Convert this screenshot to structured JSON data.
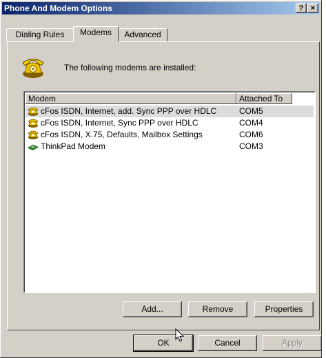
{
  "window": {
    "title": "Phone And Modem Options",
    "help_button": "?",
    "close_button": "×"
  },
  "tabs": [
    {
      "label": "Dialing Rules",
      "active": false
    },
    {
      "label": "Modems",
      "active": true
    },
    {
      "label": "Advanced",
      "active": false
    }
  ],
  "modems_tab": {
    "intro": "The following modems are installed:",
    "columns": [
      "Modem",
      "Attached To"
    ],
    "rows": [
      {
        "modem": "cFos ISDN, Internet, add. Sync PPP over HDLC",
        "port": "COM5",
        "icon": "isdn-modem-icon",
        "selected": true
      },
      {
        "modem": "cFos ISDN, Internet, Sync PPP over HDLC",
        "port": "COM4",
        "icon": "isdn-modem-icon",
        "selected": false
      },
      {
        "modem": "cFos ISDN, X.75, Defaults, Mailbox Settings",
        "port": "COM6",
        "icon": "isdn-modem-icon",
        "selected": false
      },
      {
        "modem": "ThinkPad Modem",
        "port": "COM3",
        "icon": "modem-card-icon",
        "selected": false
      }
    ],
    "buttons": {
      "add": "Add...",
      "remove": "Remove",
      "properties": "Properties"
    }
  },
  "footer": {
    "ok": "OK",
    "cancel": "Cancel",
    "apply": "Apply",
    "apply_disabled": true
  },
  "colors": {
    "title_start": "#0a246a",
    "title_end": "#a6caf0",
    "face": "#d4d0c8",
    "selection": "#dcdcdc"
  }
}
